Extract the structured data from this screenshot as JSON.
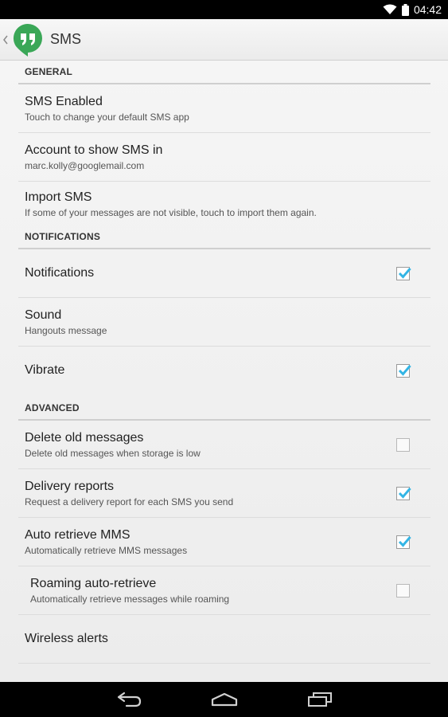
{
  "status_bar": {
    "time": "04:42"
  },
  "action_bar": {
    "title": "SMS"
  },
  "sections": [
    {
      "header": "GENERAL",
      "items": [
        {
          "title": "SMS Enabled",
          "summary": "Touch to change your default SMS app"
        },
        {
          "title": "Account to show SMS in",
          "summary": "marc.kolly@googlemail.com"
        },
        {
          "title": "Import SMS",
          "summary": "If some of your messages are not visible, touch to import them again."
        }
      ]
    },
    {
      "header": "NOTIFICATIONS",
      "items": [
        {
          "title": "Notifications",
          "checked": true
        },
        {
          "title": "Sound",
          "summary": "Hangouts message"
        },
        {
          "title": "Vibrate",
          "checked": true
        }
      ]
    },
    {
      "header": "ADVANCED",
      "items": [
        {
          "title": "Delete old messages",
          "summary": "Delete old messages when storage is low",
          "checked": false
        },
        {
          "title": "Delivery reports",
          "summary": "Request a delivery report for each SMS you send",
          "checked": true
        },
        {
          "title": "Auto retrieve MMS",
          "summary": "Automatically retrieve MMS messages",
          "checked": true
        },
        {
          "title": "Roaming auto-retrieve",
          "summary": "Automatically retrieve messages while roaming",
          "checked": false
        },
        {
          "title": "Wireless alerts"
        }
      ]
    }
  ],
  "colors": {
    "accent": "#33b5e5",
    "logo_green": "#3aa757"
  }
}
